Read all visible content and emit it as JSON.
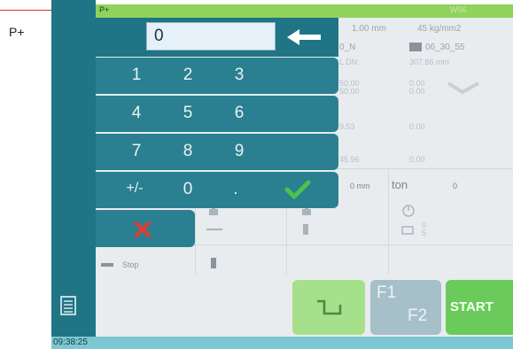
{
  "annotation": {
    "label": "P+"
  },
  "header": {
    "program": "P+",
    "mode": "W56"
  },
  "statusbar": {
    "time": "09:38:25"
  },
  "background": {
    "thickness": "1.00 mm",
    "strength": "45 kg/mm2",
    "program_name": "0_N",
    "part_code": "06_30_55",
    "l_dn_label": "L  DN:",
    "length": "307.86 mm",
    "v1a": "50.00",
    "v1b": "50.00",
    "v2a": "0.00",
    "v2b": "0.00",
    "v3a": "9.53",
    "v3b": "0.00",
    "v4a": "45.96",
    "v4b": "0.00",
    "pos": "0 mm",
    "ton_label": "ton",
    "ton_value": "0",
    "count_a": "0",
    "count_b": "5",
    "stop_label": "Stop"
  },
  "keypad": {
    "value": "0",
    "rows": [
      [
        "1",
        "2",
        "3"
      ],
      [
        "4",
        "5",
        "6"
      ],
      [
        "7",
        "8",
        "9"
      ],
      [
        "+/-",
        "0",
        "."
      ]
    ]
  },
  "buttons": {
    "f1": "F1",
    "f2": "F2",
    "start": "START"
  },
  "colors": {
    "accent": "#1f7585",
    "ok": "#4cc24c",
    "cancel": "#e43b2e",
    "start": "#6acb5b"
  },
  "icons": [
    "menu-icon",
    "backspace-icon",
    "check-icon",
    "cancel-icon",
    "bend-icon"
  ]
}
